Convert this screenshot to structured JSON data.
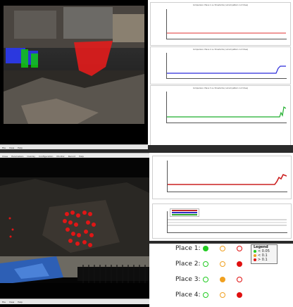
{
  "top_camera": {
    "menu_items": [
      "File",
      "View",
      "Help"
    ]
  },
  "bottom_camera": {
    "title_bar": "",
    "menu_items": [
      "File",
      "View",
      "Help"
    ],
    "toolbar_items": [
      "Close",
      "Parameters",
      "Overlay",
      "Configuration",
      "Monitor",
      "Record",
      "Help"
    ]
  },
  "top_plots": [
    {
      "title": "Comparison: Place 1 vs. thresholds (current pattern 1-2 times)",
      "color": "#e03030"
    },
    {
      "title": "Comparison: Place 2 vs. thresholds (current pattern 1-2 times)",
      "color": "#2b2bd9"
    },
    {
      "title": "Comparison: Place 3 vs. thresholds (current pattern 1-2 times)",
      "color": "#1fae2c"
    }
  ],
  "mid_plot": {
    "color": "#cc2020"
  },
  "lower_plot": {
    "legend": [
      "",
      "",
      ""
    ]
  },
  "indicator": {
    "places": [
      {
        "label": "Place 1:",
        "states": [
          "green",
          "empty",
          "empty"
        ]
      },
      {
        "label": "Place 2:",
        "states": [
          "empty",
          "empty",
          "red"
        ]
      },
      {
        "label": "Place 3:",
        "states": [
          "empty",
          "orange",
          "empty"
        ]
      },
      {
        "label": "Place 4:",
        "states": [
          "empty",
          "empty",
          "red"
        ]
      }
    ],
    "legend": {
      "title": "Legend",
      "items": [
        {
          "label": "< 0.05",
          "color": "#22cc22"
        },
        {
          "label": "< 0.1",
          "color": "#f0a020"
        },
        {
          "label": "> 0.1",
          "color": "#e01010"
        }
      ]
    },
    "colors": {
      "green": "#22cc22",
      "orange": "#f0a020",
      "red": "#e01010"
    }
  }
}
